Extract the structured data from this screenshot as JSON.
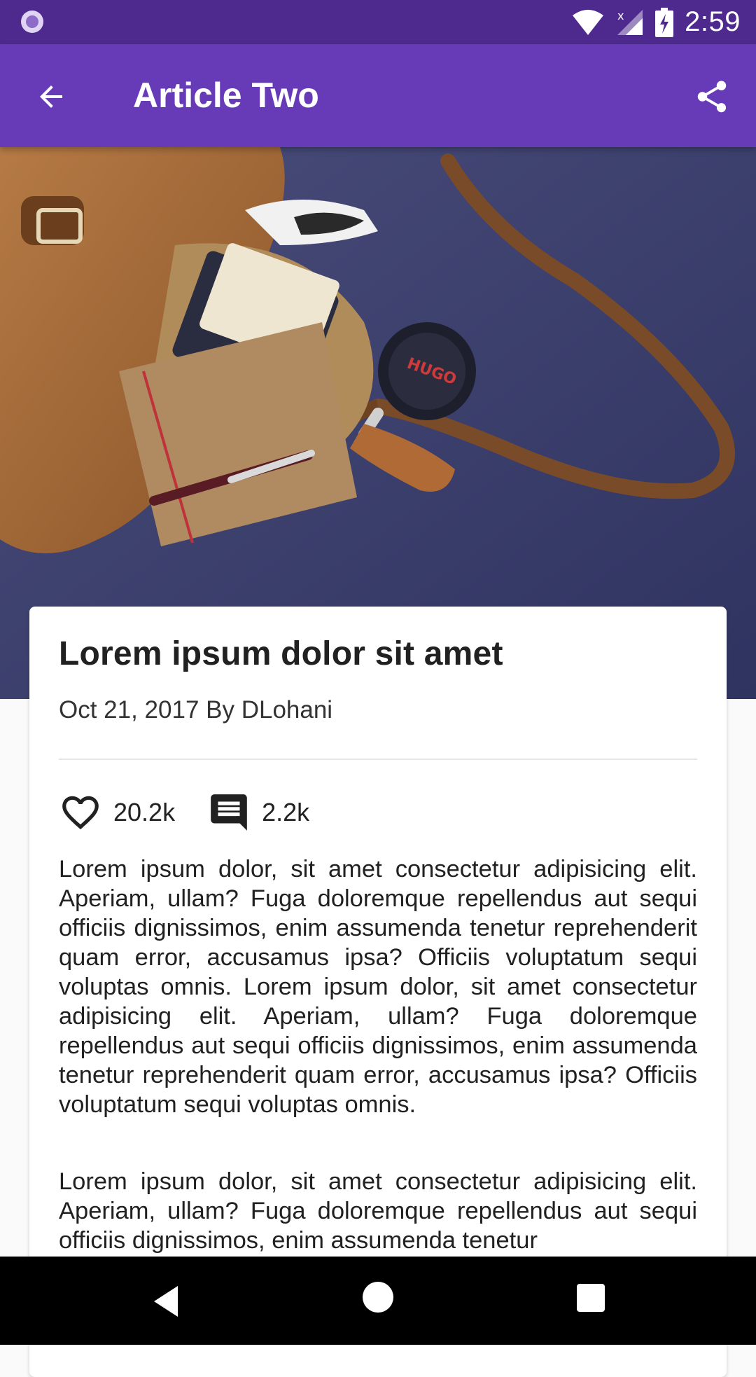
{
  "status_bar": {
    "time": "2:59",
    "icons": [
      "notification-dot-icon",
      "wifi-icon",
      "cellular-icon",
      "battery-charging-icon"
    ]
  },
  "app_bar": {
    "title": "Article Two",
    "back_icon": "arrow-back-icon",
    "share_icon": "share-icon",
    "background": "#673ab7"
  },
  "article": {
    "title": "Lorem ipsum dolor sit amet",
    "meta": "Oct 21, 2017 By DLohani",
    "likes": "20.2k",
    "comments": "2.2k",
    "paragraphs": [
      "Lorem ipsum dolor, sit amet consectetur adipisicing elit. Aperiam, ullam? Fuga doloremque repellendus aut sequi officiis dignissimos, enim assumenda tenetur reprehenderit quam error, accusamus ipsa? Officiis voluptatum sequi voluptas omnis. Lorem ipsum dolor, sit amet consectetur adipisicing elit. Aperiam, ullam? Fuga doloremque repellendus aut sequi officiis dignissimos, enim assumenda tenetur reprehenderit quam error, accusamus ipsa? Officiis voluptatum sequi voluptas omnis.",
      "Lorem ipsum dolor, sit amet consectetur adipisicing elit. Aperiam, ullam? Fuga doloremque repellendus aut sequi officiis dignissimos, enim assumenda tenetur"
    ]
  },
  "hero_image": {
    "text_on_image": "HUGO"
  },
  "nav_bar": {
    "buttons": [
      "nav-back-icon",
      "nav-home-icon",
      "nav-recents-icon"
    ]
  }
}
